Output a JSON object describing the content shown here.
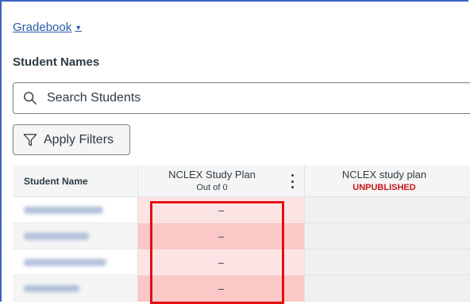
{
  "header": {
    "gradebook_label": "Gradebook"
  },
  "section": {
    "title": "Student Names"
  },
  "search": {
    "placeholder": "Search Students",
    "value": ""
  },
  "filters": {
    "apply_label": "Apply Filters"
  },
  "table": {
    "columns": [
      {
        "title": "Student Name"
      },
      {
        "title": "NCLEX Study Plan",
        "subtitle": "Out of 0"
      },
      {
        "title": "NCLEX study plan",
        "subtitle": "UNPUBLISHED"
      }
    ],
    "rows": [
      {
        "grade": "–"
      },
      {
        "grade": "–"
      },
      {
        "grade": "–"
      },
      {
        "grade": "–"
      }
    ]
  },
  "colors": {
    "link": "#2b5cab",
    "unpublished": "#c4161c",
    "highlight_border": "#e20f13",
    "cell_light": "#fde4e4",
    "cell_dark": "#fbc7c7"
  }
}
